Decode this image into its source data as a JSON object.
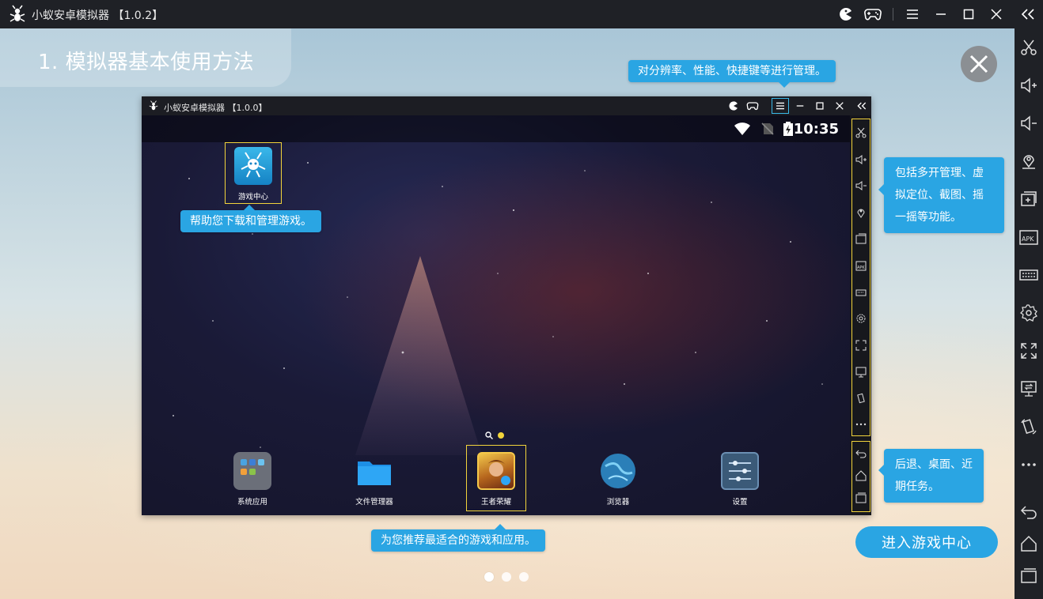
{
  "window": {
    "title": "小蚁安卓模拟器 【1.0.2】",
    "controls": [
      "pacman-icon",
      "gamepad-icon",
      "menu-icon",
      "minimize-icon",
      "maximize-icon",
      "close-icon",
      "collapse-icon"
    ]
  },
  "sidebar": {
    "items": [
      "scissors-icon",
      "volume-up-icon",
      "volume-down-icon",
      "location-icon",
      "multi-instance-icon",
      "apk-icon",
      "keyboard-icon",
      "settings-icon",
      "fullscreen-icon",
      "screen-share-icon",
      "rotate-icon",
      "more-icon",
      "back-icon",
      "home-icon",
      "recent-icon"
    ]
  },
  "tutorial": {
    "heading": "1. 模拟器基本使用方法",
    "callouts": {
      "settings": "对分辨率、性能、快捷键等进行管理。",
      "game_center": "帮助您下载和管理游戏。",
      "sidebar": "包括多开管理、虚拟定位、截图、摇一摇等功能。",
      "nav": "后退、桌面、近期任务。",
      "recommend": "为您推荐最适合的游戏和应用。"
    },
    "enter_button": "进入游戏中心",
    "pager": {
      "total": 3,
      "current": 1
    }
  },
  "inner": {
    "title": "小蚁安卓模拟器 【1.0.0】",
    "time": "10:35",
    "desktop_app": "游戏中心",
    "dock": [
      {
        "label": "系统应用"
      },
      {
        "label": "文件管理器"
      },
      {
        "label": "王者荣耀"
      },
      {
        "label": "浏览器"
      },
      {
        "label": "设置"
      }
    ]
  },
  "colors": {
    "accent": "#2aa5e3",
    "highlight": "#f2d43b",
    "titlebar": "#1f2126"
  }
}
